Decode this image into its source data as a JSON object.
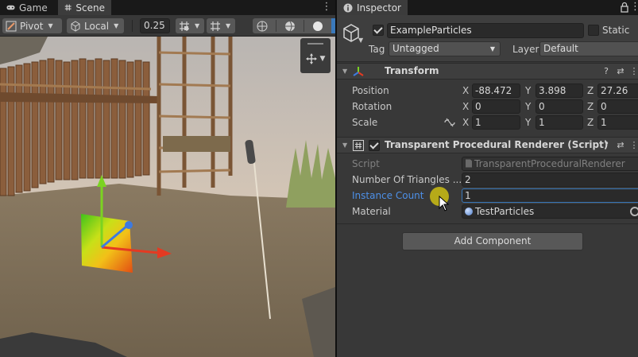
{
  "scene_panel": {
    "tabs": [
      {
        "label": "Game",
        "icon": "gamepad-icon",
        "active": false
      },
      {
        "label": "Scene",
        "icon": "grid-hash-icon",
        "active": true
      }
    ],
    "toolbar": {
      "pivot_label": "Pivot",
      "local_label": "Local",
      "snap_value": "0.25"
    }
  },
  "inspector": {
    "tab_label": "Inspector",
    "object": {
      "name": "ExampleParticles",
      "active": true,
      "static_label": "Static",
      "static": false,
      "tag_label": "Tag",
      "tag_value": "Untagged",
      "layer_label": "Layer",
      "layer_value": "Default"
    },
    "transform": {
      "title": "Transform",
      "position_label": "Position",
      "rotation_label": "Rotation",
      "scale_label": "Scale",
      "axis_x": "X",
      "axis_y": "Y",
      "axis_z": "Z",
      "position": {
        "x": "-88.472",
        "y": "3.898",
        "z": "27.26"
      },
      "rotation": {
        "x": "0",
        "y": "0",
        "z": "0"
      },
      "scale": {
        "x": "1",
        "y": "1",
        "z": "1"
      }
    },
    "renderer": {
      "title": "Transparent Procedural Renderer (Script)",
      "enabled": true,
      "script_label": "Script",
      "script_value": "TransparentProceduralRenderer",
      "triangles_label": "Number Of Triangles ...",
      "triangles_value": "2",
      "instance_label": "Instance Count",
      "instance_value": "1",
      "material_label": "Material",
      "material_value": "TestParticles"
    },
    "add_component_label": "Add Component"
  },
  "colors": {
    "accent_blue": "#3a79bb",
    "highlight_label": "#4d90e8",
    "cursor_halo": "#cdbe14"
  }
}
